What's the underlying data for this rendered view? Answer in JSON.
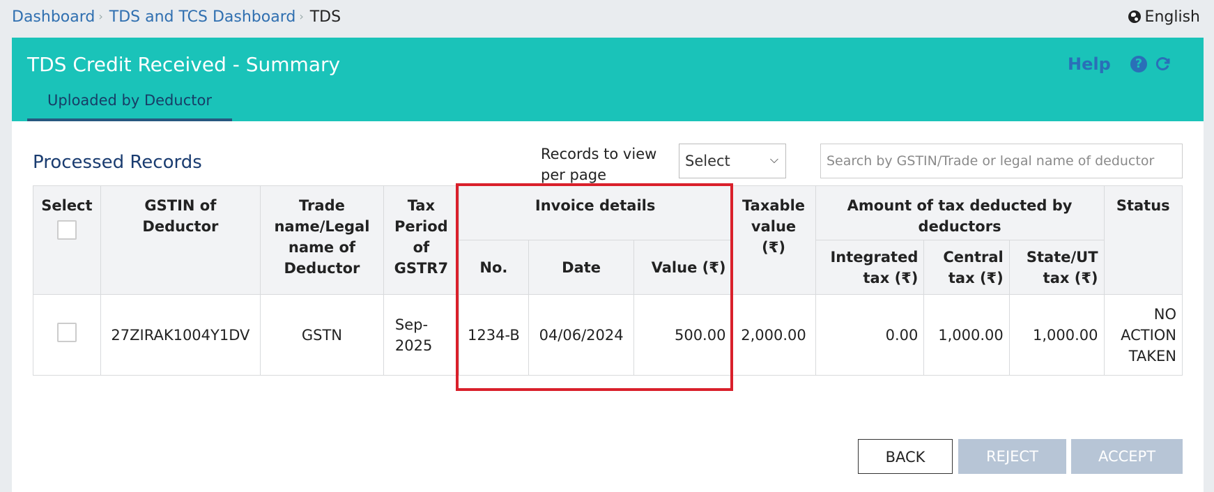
{
  "breadcrumb": {
    "items": [
      "Dashboard",
      "TDS and TCS Dashboard"
    ],
    "current": "TDS",
    "separator": "›"
  },
  "language": "English",
  "header": {
    "title": "TDS Credit Received - Summary",
    "help_label": "Help",
    "tab_label": "Uploaded by Deductor",
    "bg_color": "#1ac3b9"
  },
  "section": {
    "title": "Processed Records",
    "records_per_page_label": "Records to view per page",
    "records_per_page_value": "Select",
    "search_placeholder": "Search by GSTIN/Trade or legal name of deductor"
  },
  "table": {
    "headers": {
      "select": "Select",
      "gstin": "GSTIN of Deductor",
      "trade_name": "Trade name/Legal name of Deductor",
      "tax_period": "Tax Period of GSTR7",
      "invoice_details": "Invoice details",
      "invoice_no": "No.",
      "invoice_date": "Date",
      "invoice_value": "Value (₹)",
      "taxable_value": "Taxable value (₹)",
      "amount_tax": "Amount of tax deducted by deductors",
      "integrated_tax": "Integrated tax (₹)",
      "central_tax": "Central tax (₹)",
      "state_ut_tax": "State/UT tax (₹)",
      "status": "Status"
    },
    "rows": [
      {
        "gstin": "27ZIRAK1004Y1DV",
        "trade_name": "GSTN",
        "tax_period": "Sep-2025",
        "invoice_no": "1234-B",
        "invoice_date": "04/06/2024",
        "invoice_value": "500.00",
        "taxable_value": "2,000.00",
        "integrated_tax": "0.00",
        "central_tax": "1,000.00",
        "state_ut_tax": "1,000.00",
        "status": "NO ACTION TAKEN"
      }
    ]
  },
  "buttons": {
    "back": "BACK",
    "reject": "REJECT",
    "accept": "ACCEPT"
  },
  "highlight_color": "#d9202b"
}
